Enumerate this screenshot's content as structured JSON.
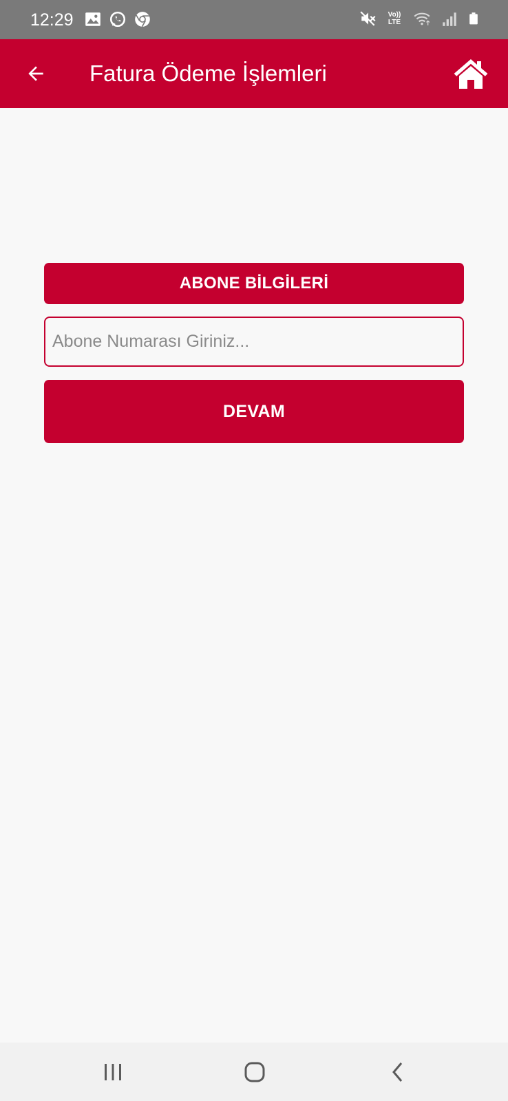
{
  "status_bar": {
    "time": "12:29",
    "left_icons": [
      "image-icon",
      "whatsapp-icon",
      "chrome-icon"
    ],
    "right_icons": [
      "mute-icon",
      "volte-icon",
      "wifi-icon",
      "signal-icon",
      "battery-icon"
    ],
    "volte_label_top": "Vo))",
    "volte_label_bottom": "LTE"
  },
  "app_bar": {
    "title": "Fatura Ödeme İşlemleri",
    "back_icon": "arrow-left-icon",
    "home_icon": "home-icon"
  },
  "form": {
    "section_header": "ABONE BİLGİLERİ",
    "subscriber_input": {
      "value": "",
      "placeholder": "Abone Numarası Giriniz..."
    },
    "continue_label": "DEVAM"
  },
  "nav_bar": {
    "items": [
      "recent-apps-icon",
      "home-circle-icon",
      "back-chevron-icon"
    ]
  },
  "colors": {
    "primary": "#c4002f",
    "status_bar": "#7a7a7a",
    "background": "#f8f8f8",
    "nav_bar": "#f1f1f1"
  }
}
